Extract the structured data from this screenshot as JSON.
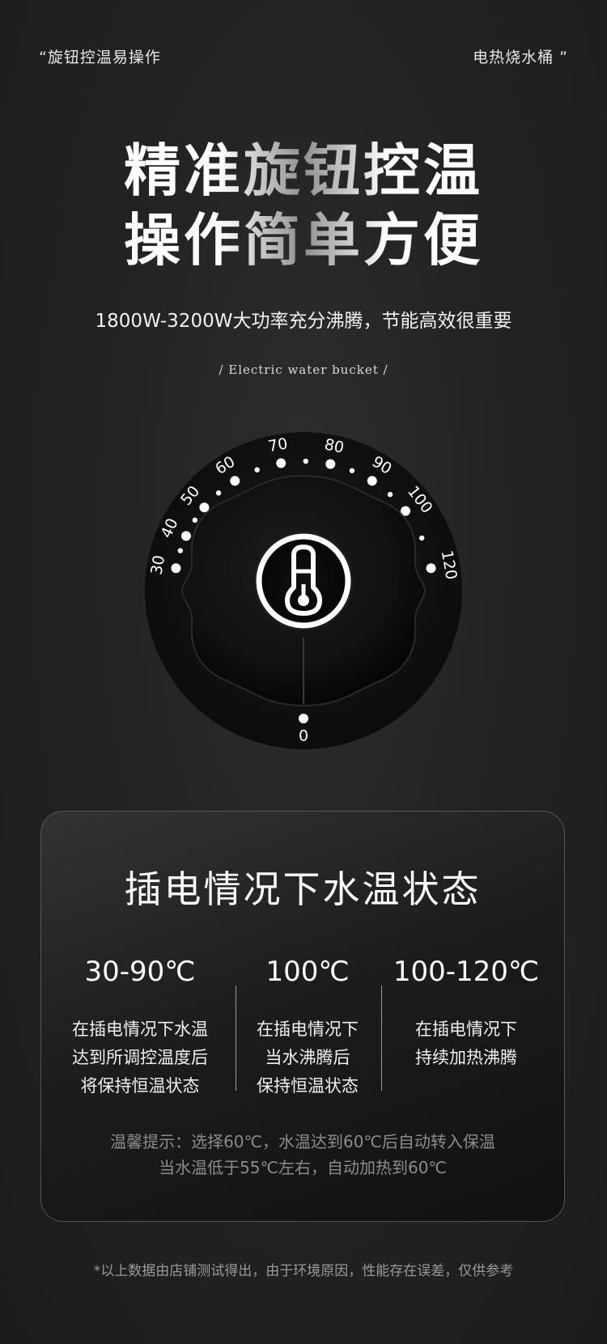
{
  "top_left_tag": "“旋钮控温易操作",
  "top_right_tag": "电热烧水桶 ”",
  "headline_line1": "精准旋钮控温",
  "headline_line2": "操作简单方便",
  "subline": "1800W-3200W大功率充分沸腾，节能高效很重要",
  "en_tag": "/ Electric water bucket /",
  "knob": {
    "icon": "thermometer-icon",
    "scale_labels": [
      "30",
      "40",
      "50",
      "60",
      "70",
      "80",
      "90",
      "100",
      "120"
    ],
    "zero_label": "0"
  },
  "card": {
    "title": "插电情况下水温状态",
    "columns": [
      {
        "temp": "30-90℃",
        "lines": [
          "在插电情况下水温",
          "达到所调控温度后",
          "将保持恒温状态"
        ]
      },
      {
        "temp": "100℃",
        "lines": [
          "在插电情况下",
          "当水沸腾后",
          "保持恒温状态"
        ]
      },
      {
        "temp": "100-120℃",
        "lines": [
          "在插电情况下",
          "持续加热沸腾"
        ]
      }
    ],
    "tip_line1": "温馨提示：选择60℃，水温达到60℃后自动转入保温",
    "tip_line2": "当水温低于55℃左右，自动加热到60℃"
  },
  "footnote": "*以上数据由店铺测试得出，由于环境原因，性能存在误差，仅供参考",
  "colors": {
    "background": "#232323",
    "text": "#ffffff",
    "muted": "#8c8c8c"
  }
}
